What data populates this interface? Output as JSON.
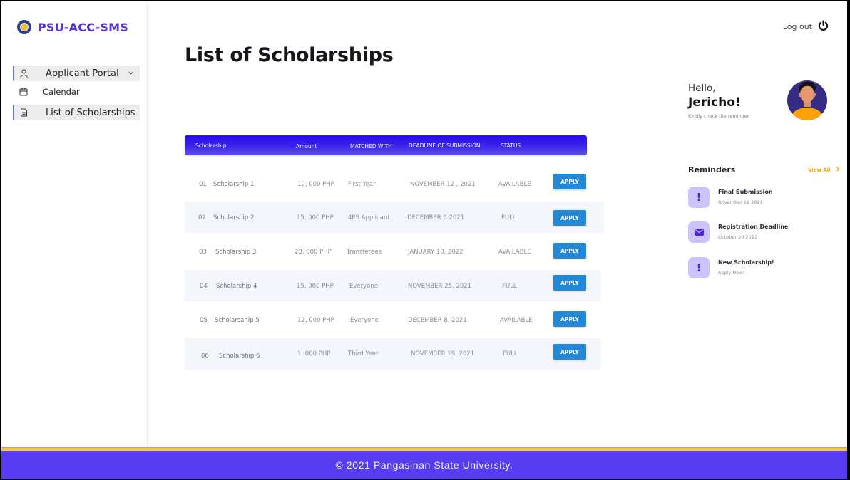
{
  "app": {
    "brand": "PSU-ACC-SMS"
  },
  "sidebar": {
    "items": [
      {
        "label": "Applicant Portal",
        "icon": "user-icon",
        "expandable": true,
        "active": true
      },
      {
        "label": "Calendar",
        "icon": "calendar-icon",
        "expandable": false,
        "active": false
      },
      {
        "label": "List of Scholarships",
        "icon": "document-icon",
        "expandable": false,
        "active": true
      }
    ]
  },
  "header": {
    "logout_label": "Log out",
    "logout_icon": "power-icon"
  },
  "main": {
    "title": "List of Scholarships",
    "table": {
      "columns": [
        "Scholarship",
        "Amount",
        "MATCHED WITH",
        "DEADLINE OF SUBMISSION",
        "STATUS"
      ],
      "rows": [
        {
          "num": "01",
          "name": "Scholarship 1",
          "amount": "10, 000 PHP",
          "matched": "First Year",
          "deadline": "NOVEMBER 12 , 2021",
          "status": "AVAILABLE",
          "action": "APPLY"
        },
        {
          "num": "02",
          "name": "Scholarship 2",
          "amount": "15. 000 PHP",
          "matched": "4PS Applicant",
          "deadline": "DECEMBER 6 2021",
          "status": "FULL",
          "action": "APPLY"
        },
        {
          "num": "03",
          "name": "Scholarship 3",
          "amount": "20, 000 PHP",
          "matched": "Transferees",
          "deadline": "JANUARY 10, 2022",
          "status": "AVAILABLE",
          "action": "APPLY"
        },
        {
          "num": "04",
          "name": "Scholarship 4",
          "amount": "15, 000 PHP",
          "matched": "Everyone",
          "deadline": "NOVEMBER 25, 2021",
          "status": "FULL",
          "action": "APPLY"
        },
        {
          "num": "05",
          "name": "Scholarsahip 5",
          "amount": "12, 000 PHP",
          "matched": "Everyone",
          "deadline": "DECEMBER 8,  2021",
          "status": "AVAILABLE",
          "action": "APPLY"
        },
        {
          "num": "06",
          "name": "Scholarship 6",
          "amount": "1, 000 PHP",
          "matched": "Third Year",
          "deadline": "NOVEMBER 19, 2021",
          "status": "FULL",
          "action": "APPLY"
        }
      ]
    }
  },
  "greeting": {
    "hello": "Hello,",
    "name": "Jericho!",
    "subtitle": "Kindly check the reminder"
  },
  "reminders": {
    "title": "Reminders",
    "view_all": "View All",
    "items": [
      {
        "icon": "exclamation-icon",
        "title": "Final Submission",
        "subtitle": "November 12 2021"
      },
      {
        "icon": "mail-icon",
        "title": "Registration Deadline",
        "subtitle": "October 20 2021"
      },
      {
        "icon": "exclamation-icon",
        "title": "New Scholarship!",
        "subtitle": "Apply Now!"
      }
    ]
  },
  "footer": {
    "text": "© 2021 Pangasinan State University."
  },
  "colors": {
    "brand": "#5a33d6",
    "table_header_top": "#2a0be8",
    "table_header_bottom": "#5d4fe4",
    "apply_button": "#2389d6",
    "footer_bg": "#583df0",
    "footer_stripe": "#f5cd3a",
    "view_all": "#f7a600",
    "reminder_icon_bg": "#cbc3fb"
  }
}
